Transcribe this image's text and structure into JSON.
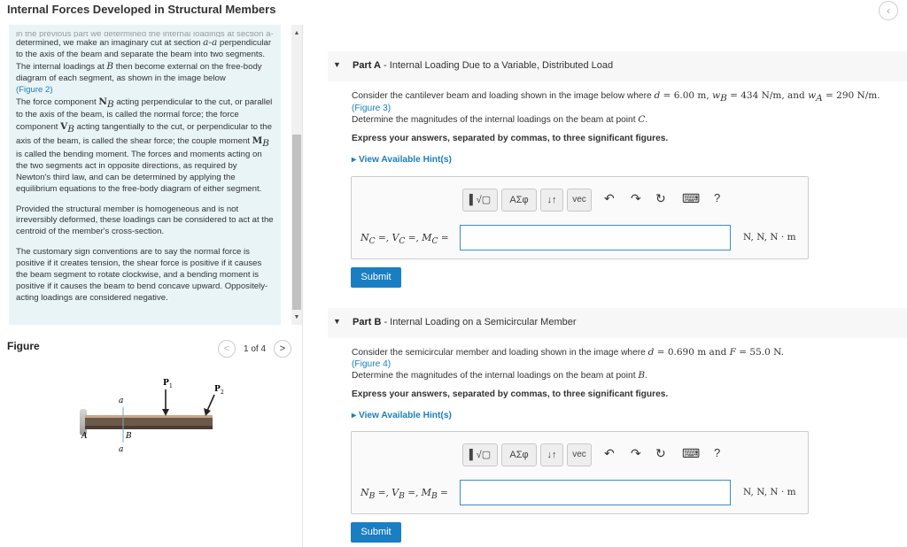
{
  "window": {
    "title": "Internal Forces Developed in Structural Members",
    "close_glyph": "‹"
  },
  "intro": {
    "faded_line": "in the previous part we determined the internal loadings at section a-a",
    "p1": [
      "determined, we make an imaginary cut at section ",
      "a-a",
      " perpendicular to the axis of the beam and separate the beam into two segments. The internal loadings at ",
      "B",
      " then become external on the free-body diagram of each segment, as shown in the image below"
    ],
    "figure2_link": "(Figure 2)",
    "p2": [
      "The force component ",
      "N",
      "B",
      " acting perpendicular to the cut, or parallel to the axis of the beam, is called the normal force; the force component ",
      "V",
      "B",
      " acting tangentially to the cut, or perpendicular to the axis of the beam, is called the shear force; the couple moment ",
      "M",
      "B",
      " is called the bending moment. The forces and moments acting on the two segments act in opposite directions, as required by Newton's third law, and can be determined by applying the equilibrium equations to the free-body diagram of either segment."
    ],
    "p3": "Provided the structural member is homogeneous and is not irreversibly deformed, these loadings can be considered to act at the centroid of the member's cross-section.",
    "p4": "The customary sign conventions are to say the normal force is positive if it creates tension, the shear force is positive if it causes the beam segment to rotate clockwise, and a bending moment is positive if it causes the beam to bend concave upward. Oppositely-acting loadings are considered negative."
  },
  "figure": {
    "label": "Figure",
    "counter": "1 of 4",
    "prev_glyph": "<",
    "next_glyph": ">",
    "labels": {
      "p1": "P",
      "p1_sub": "1",
      "p2": "P",
      "p2_sub": "2",
      "a_top": "a",
      "a_bottom": "a",
      "A": "A",
      "B": "B"
    }
  },
  "partA": {
    "letter": "Part A",
    "title": " - Internal Loading Due to a Variable, Distributed Load",
    "problem": [
      "Consider the cantilever beam and loading shown in the image below where ",
      "d",
      " = 6.00 m, ",
      "w",
      "B",
      " = 434 N/m, and ",
      "w",
      "A",
      " = 290 N/m."
    ],
    "figure_link": "(Figure 3)",
    "determine": [
      "Determine the magnitudes of the internal loadings on the beam at point ",
      "C",
      "."
    ],
    "instruction": "Express your answers, separated by commas, to three significant figures.",
    "hint": "View Available Hint(s)",
    "answer_label": [
      "N",
      "C",
      " =, ",
      "V",
      "C",
      " =, ",
      "M",
      "C",
      " ="
    ],
    "input_value": "",
    "units": "N, N, N · m",
    "submit": "Submit"
  },
  "partB": {
    "letter": "Part B",
    "title": " - Internal Loading on a Semicircular Member",
    "problem": [
      "Consider the semicircular member and loading shown in the image where ",
      "d",
      " = 0.690 m and ",
      "F",
      " = 55.0 N."
    ],
    "figure_link": "(Figure 4)",
    "determine": [
      "Determine the magnitudes of the internal loadings on the beam at point ",
      "B",
      "."
    ],
    "instruction": "Express your answers, separated by commas, to three significant figures.",
    "hint": "View Available Hint(s)",
    "answer_label": [
      "N",
      "B",
      " =, ",
      "V",
      "B",
      " =, ",
      "M",
      "B",
      " ="
    ],
    "input_value": "",
    "units": "N, N, N · m",
    "submit": "Submit"
  },
  "toolbar": {
    "templates": "▌√▢",
    "symbols": "ΑΣφ",
    "arrows": "↓↑",
    "vec": "vec",
    "undo": "↶",
    "redo": "↷",
    "reset": "↻",
    "keyboard": "⌨",
    "help": "?"
  },
  "colors": {
    "accent": "#1a7ec2",
    "intro_bg": "#e9f4f6",
    "part_header_bg": "#f7f7f7"
  }
}
